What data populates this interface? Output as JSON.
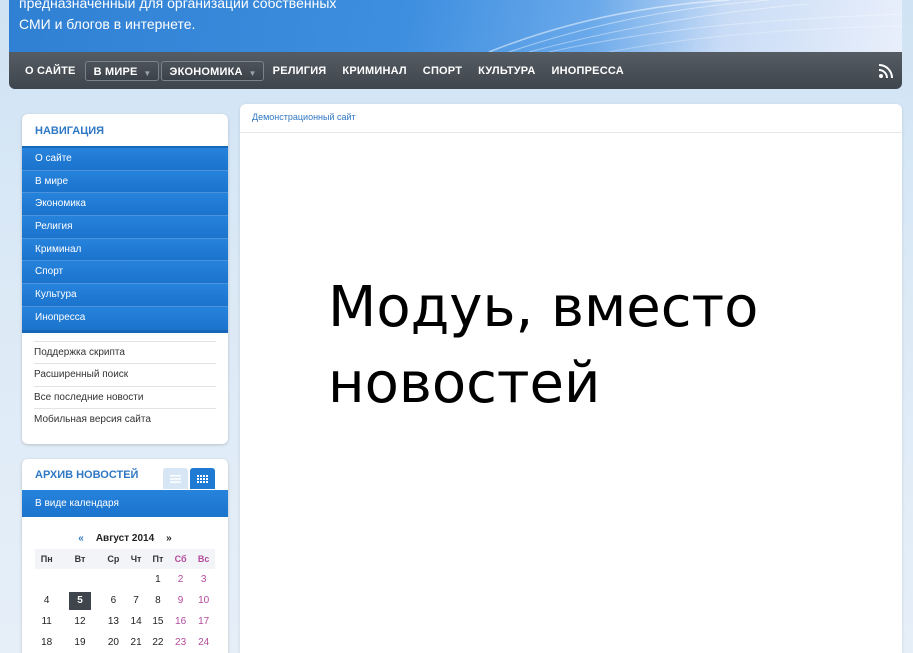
{
  "banner": {
    "line1": "предназначенный для организации собственных",
    "line2": "СМИ и блогов в интернете."
  },
  "topnav": {
    "items": [
      "О САЙТЕ",
      "В МИРЕ",
      "ЭКОНОМИКА",
      "РЕЛИГИЯ",
      "КРИМИНАЛ",
      "СПОРТ",
      "КУЛЬТУРА",
      "ИНОПРЕССА"
    ]
  },
  "navigation": {
    "title": "НАВИГАЦИЯ",
    "main_items": [
      "О сайте",
      "В мире",
      "Экономика",
      "Религия",
      "Криминал",
      "Спорт",
      "Культура",
      "Инопресса"
    ],
    "extra_items": [
      "Поддержка скрипта",
      "Расширенный поиск",
      "Все последние новости",
      "Мобильная версия сайта"
    ]
  },
  "archive": {
    "title": "АРХИВ НОВОСТЕЙ",
    "subtitle": "В виде календаря",
    "calendar": {
      "prev": "«",
      "month": "Август 2014",
      "next": "»",
      "weekdays": [
        "Пн",
        "Вт",
        "Ср",
        "Чт",
        "Пт",
        "Сб",
        "Вс"
      ],
      "weeks": [
        [
          "",
          "",
          "",
          "",
          "1",
          "2",
          "3"
        ],
        [
          "4",
          "5",
          "6",
          "7",
          "8",
          "9",
          "10"
        ],
        [
          "11",
          "12",
          "13",
          "14",
          "15",
          "16",
          "17"
        ],
        [
          "18",
          "19",
          "20",
          "21",
          "22",
          "23",
          "24"
        ]
      ],
      "today": "5"
    }
  },
  "main": {
    "breadcrumb": "Демонстрационный сайт",
    "big_text": "Модуь, вместо новостей"
  },
  "colors": {
    "accent": "#1e7ad3",
    "navbar": "#3e454c",
    "weekend": "#b34a9d"
  }
}
